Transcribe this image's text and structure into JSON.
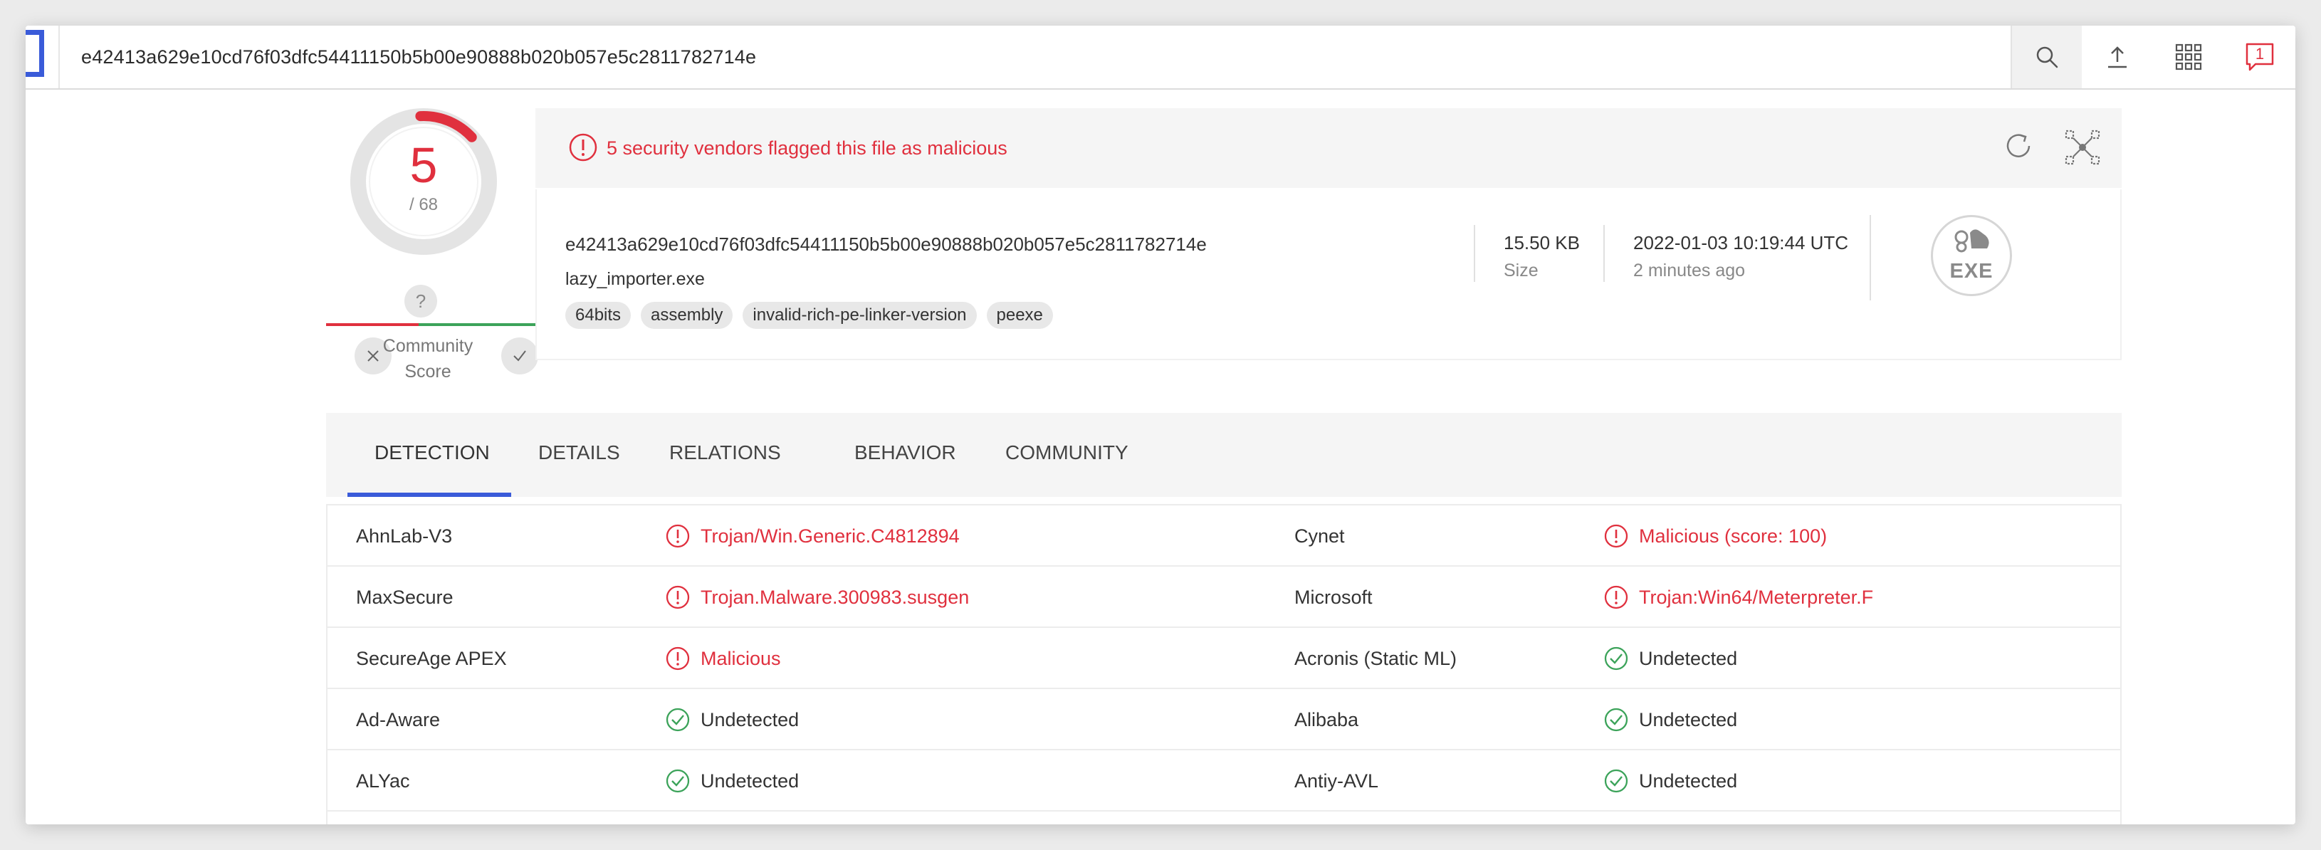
{
  "search": {
    "query": "e42413a629e10cd76f03dfc54411150b5b00e90888b020b057e5c2811782714e"
  },
  "topbar": {
    "notification_count": "1"
  },
  "score": {
    "detections": "5",
    "total": "/ 68"
  },
  "community": {
    "unknown": "?",
    "label_line1": "Community",
    "label_line2": "Score"
  },
  "banner": {
    "text": "5 security vendors flagged this file as malicious"
  },
  "file": {
    "hash": "e42413a629e10cd76f03dfc54411150b5b00e90888b020b057e5c2811782714e",
    "name": "lazy_importer.exe",
    "tags": [
      "64bits",
      "assembly",
      "invalid-rich-pe-linker-version",
      "peexe"
    ],
    "size": "15.50 KB",
    "size_label": "Size",
    "date": "2022-01-03 10:19:44 UTC",
    "date_ago": "2 minutes ago",
    "type_badge": "EXE"
  },
  "tabs": [
    "DETECTION",
    "DETAILS",
    "RELATIONS",
    "BEHAVIOR",
    "COMMUNITY"
  ],
  "colors": {
    "malicious": "#e0303e",
    "undetected": "#3ca35a",
    "accent": "#3a5bd9"
  },
  "detections": [
    {
      "left": {
        "vendor": "AhnLab-V3",
        "result": "Trojan/Win.Generic.C4812894",
        "status": "malicious"
      },
      "right": {
        "vendor": "Cynet",
        "result": "Malicious (score: 100)",
        "status": "malicious"
      }
    },
    {
      "left": {
        "vendor": "MaxSecure",
        "result": "Trojan.Malware.300983.susgen",
        "status": "malicious"
      },
      "right": {
        "vendor": "Microsoft",
        "result": "Trojan:Win64/Meterpreter.F",
        "status": "malicious"
      }
    },
    {
      "left": {
        "vendor": "SecureAge APEX",
        "result": "Malicious",
        "status": "malicious"
      },
      "right": {
        "vendor": "Acronis (Static ML)",
        "result": "Undetected",
        "status": "undetected"
      }
    },
    {
      "left": {
        "vendor": "Ad-Aware",
        "result": "Undetected",
        "status": "undetected"
      },
      "right": {
        "vendor": "Alibaba",
        "result": "Undetected",
        "status": "undetected"
      }
    },
    {
      "left": {
        "vendor": "ALYac",
        "result": "Undetected",
        "status": "undetected"
      },
      "right": {
        "vendor": "Antiy-AVL",
        "result": "Undetected",
        "status": "undetected"
      }
    }
  ]
}
